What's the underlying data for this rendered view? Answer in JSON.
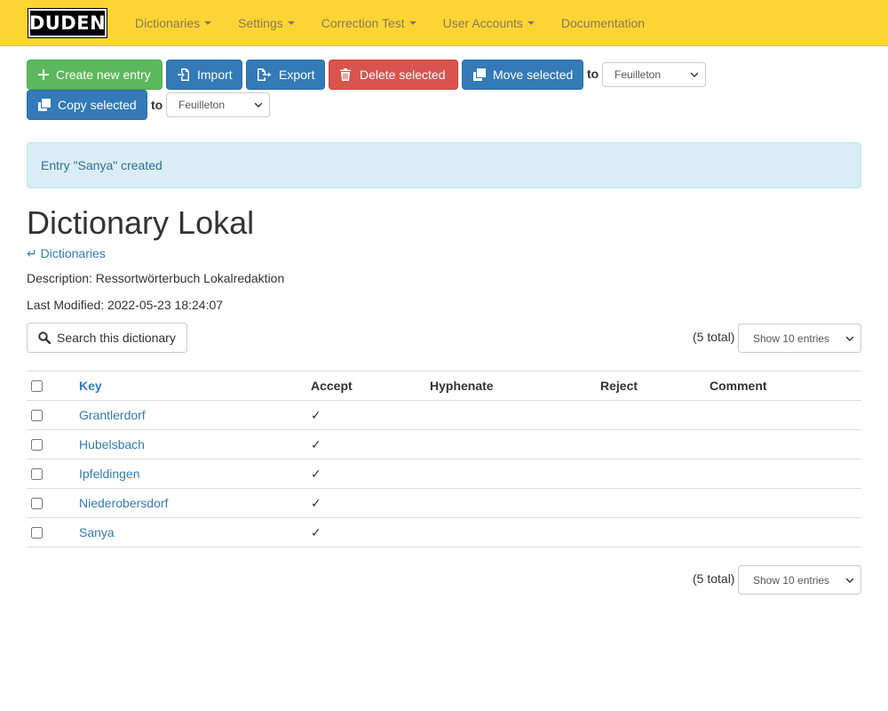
{
  "brand": {
    "logo_text": "DUDEN",
    "color": "#fcd535"
  },
  "nav": {
    "items": [
      {
        "label": "Dictionaries",
        "dropdown": true
      },
      {
        "label": "Settings",
        "dropdown": true
      },
      {
        "label": "Correction Test",
        "dropdown": true
      },
      {
        "label": "User Accounts",
        "dropdown": true
      },
      {
        "label": "Documentation",
        "dropdown": false
      }
    ]
  },
  "toolbar": {
    "create_label": "Create new entry",
    "import_label": "Import",
    "export_label": "Export",
    "delete_label": "Delete selected",
    "move_label": "Move selected",
    "copy_label": "Copy selected",
    "to_label": "to",
    "move_target": "Feuilleton",
    "copy_target": "Feuilleton"
  },
  "alert": {
    "message": "Entry \"Sanya\" created"
  },
  "page": {
    "title": "Dictionary Lokal",
    "back_link": "↵ Dictionaries",
    "description": "Description: Ressortwörterbuch Lokalredaktion",
    "last_modified": "Last Modified: 2022-05-23 18:24:07",
    "search_label": "Search this dictionary",
    "total_text": "(5 total)",
    "page_size": "Show 10 entries"
  },
  "table": {
    "headers": {
      "key": "Key",
      "accept": "Accept",
      "hyphenate": "Hyphenate",
      "reject": "Reject",
      "comment": "Comment"
    },
    "rows": [
      {
        "key": "Grantlerdorf",
        "accept": "✓",
        "hyphenate": "",
        "reject": "",
        "comment": ""
      },
      {
        "key": "Hubelsbach",
        "accept": "✓",
        "hyphenate": "",
        "reject": "",
        "comment": ""
      },
      {
        "key": "Ipfeldingen",
        "accept": "✓",
        "hyphenate": "",
        "reject": "",
        "comment": ""
      },
      {
        "key": "Niederobersdorf",
        "accept": "✓",
        "hyphenate": "",
        "reject": "",
        "comment": ""
      },
      {
        "key": "Sanya",
        "accept": "✓",
        "hyphenate": "",
        "reject": "",
        "comment": ""
      }
    ]
  }
}
